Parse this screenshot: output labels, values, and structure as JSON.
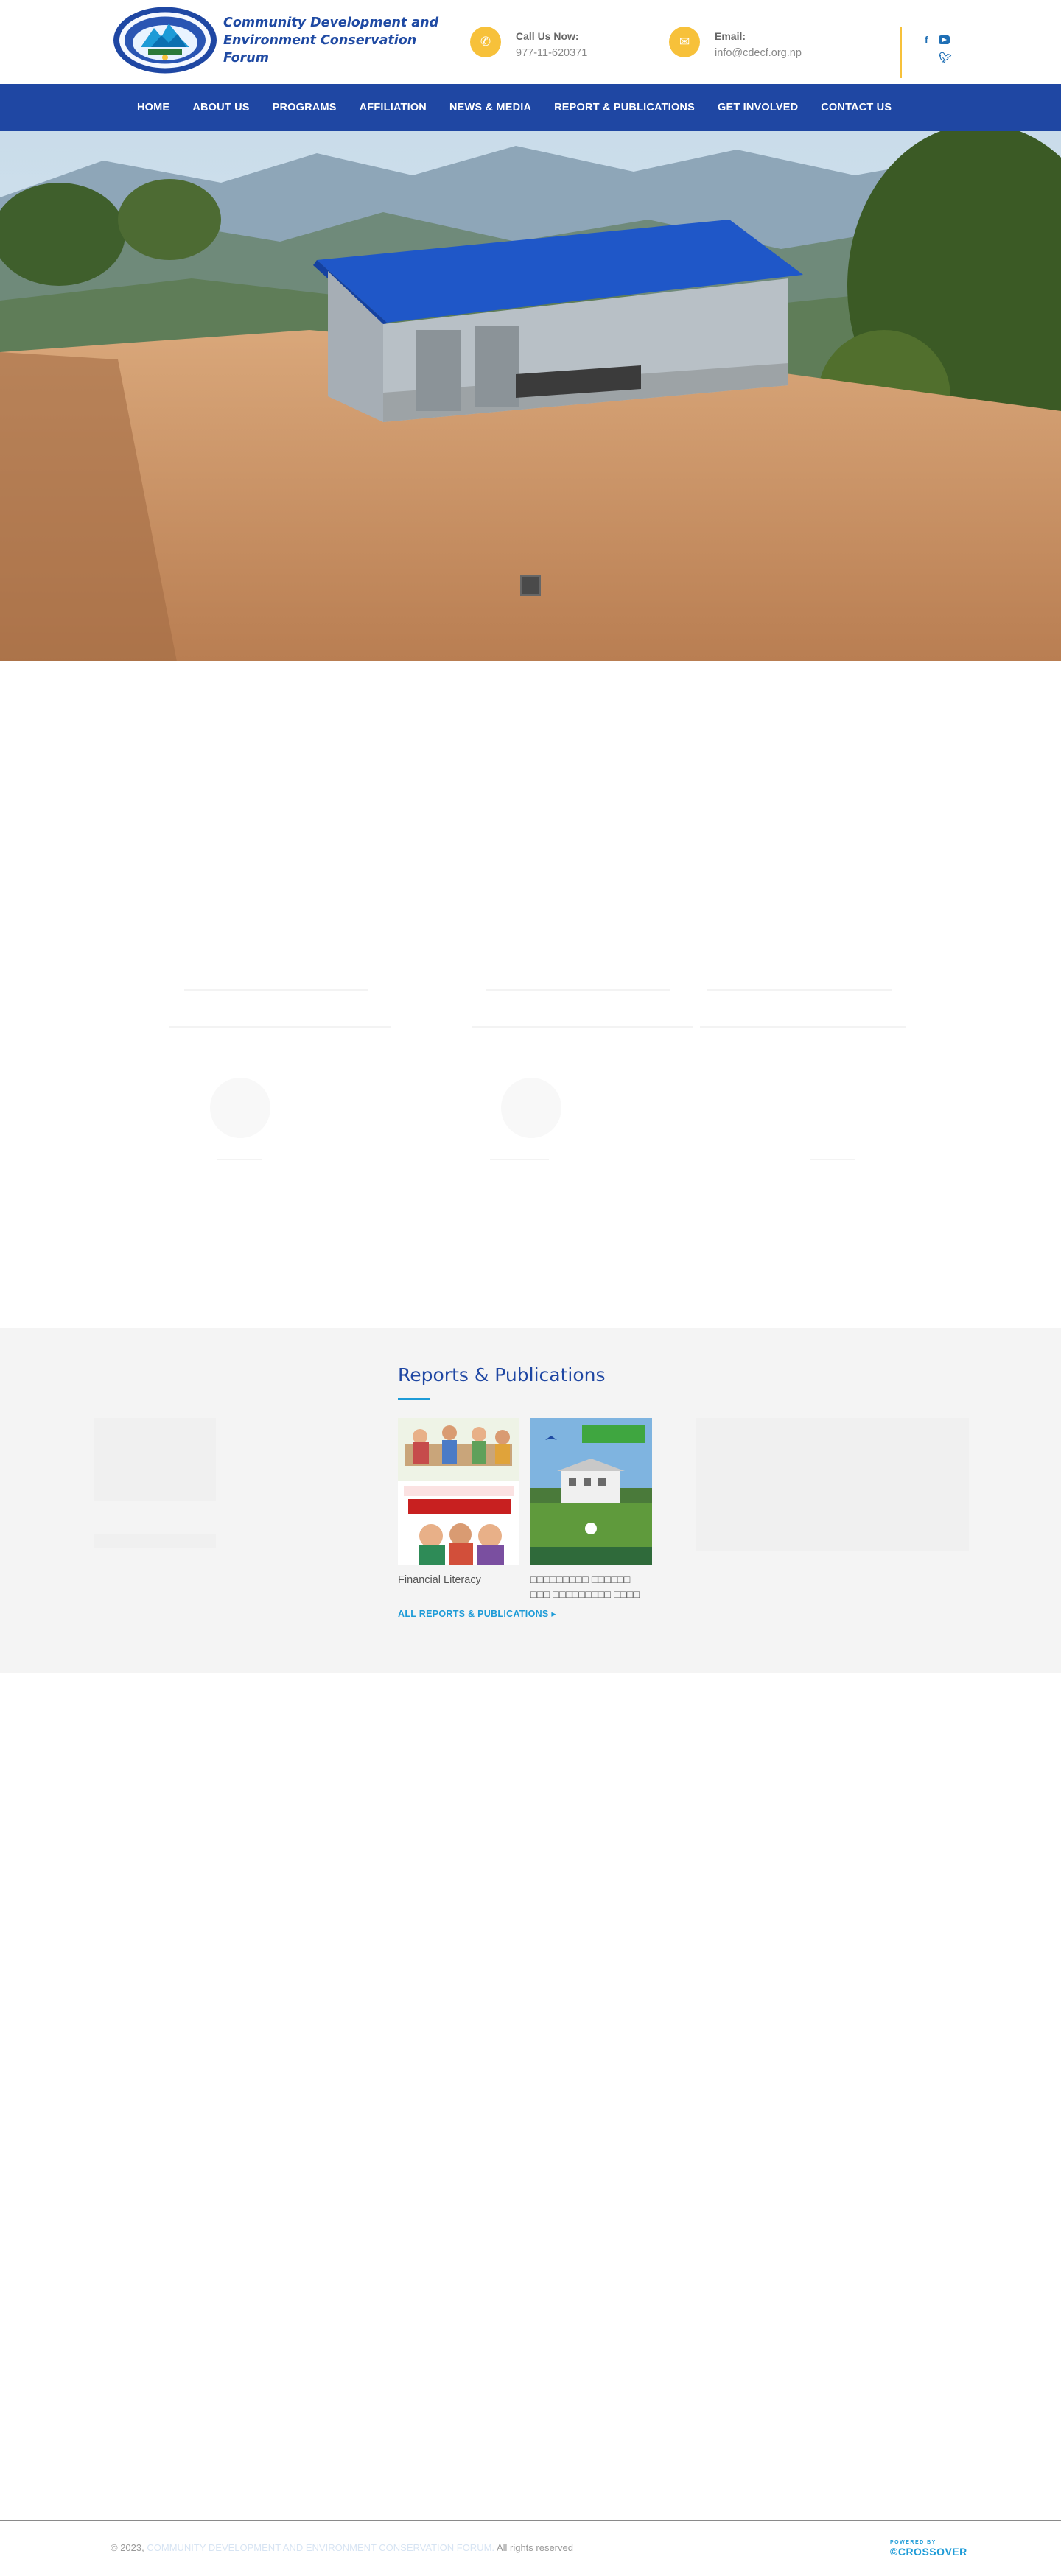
{
  "header": {
    "org_name": "Community Development and Environment Conservation Forum",
    "phone_label": "Call Us Now:",
    "phone_value": "977-11-620371",
    "email_label": "Email:",
    "email_value": "info@cdecf.org.np",
    "brand_color": "#1f47a3",
    "accent_color": "#f7c13a"
  },
  "nav": {
    "items": [
      "HOME",
      "ABOUT US",
      "PROGRAMS",
      "AFFILIATION",
      "NEWS & MEDIA",
      "REPORT & PUBLICATIONS",
      "GET INVOLVED",
      "CONTACT US"
    ]
  },
  "reports": {
    "title": "Reports & Publications",
    "items": [
      {
        "caption": "Financial Literacy"
      },
      {
        "caption": "□□□□□□□□□ □□□□□□ □□□ □□□□□□□□□ □□□□"
      }
    ],
    "all_link": "ALL REPORTS & PUBLICATIONS"
  },
  "footer": {
    "copyright_prefix": "© 2023,",
    "copyright_org": "COMMUNITY DEVELOPMENT AND ENVIRONMENT CONSERVATION FORUM.",
    "copyright_suffix": "All rights reserved",
    "powered_by": "POWERED BY",
    "powered_brand": "CROSSOVER"
  }
}
